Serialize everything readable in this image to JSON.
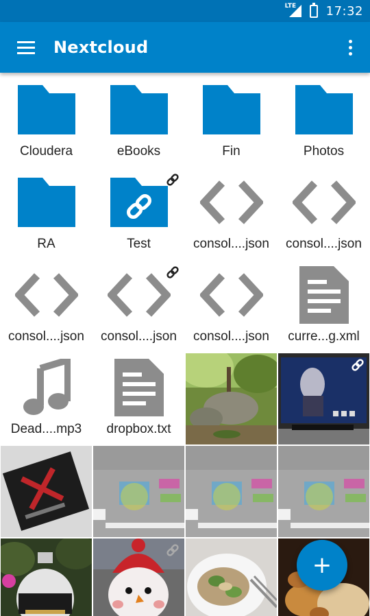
{
  "status_bar": {
    "network": "LTE",
    "time": "17:32"
  },
  "app_bar": {
    "title": "Nextcloud"
  },
  "colors": {
    "accent": "#0082c9",
    "statusbar": "#0072b5",
    "file_icon_gray": "#8c8c8c"
  },
  "items": [
    {
      "name": "Cloudera",
      "type": "folder",
      "icon": "folder-icon"
    },
    {
      "name": "eBooks",
      "type": "folder",
      "icon": "folder-icon"
    },
    {
      "name": "Fin",
      "type": "folder",
      "icon": "folder-icon"
    },
    {
      "name": "Photos",
      "type": "folder",
      "icon": "folder-icon"
    },
    {
      "name": "RA",
      "type": "folder",
      "icon": "folder-icon"
    },
    {
      "name": "Test",
      "type": "shared-folder",
      "icon": "link-folder-icon",
      "shared": true
    },
    {
      "name": "consol....json",
      "type": "code",
      "icon": "code-file-icon"
    },
    {
      "name": "consol....json",
      "type": "code",
      "icon": "code-file-icon"
    },
    {
      "name": "consol....json",
      "type": "code",
      "icon": "code-file-icon"
    },
    {
      "name": "consol....json",
      "type": "code",
      "icon": "code-file-icon",
      "shared": true
    },
    {
      "name": "consol....json",
      "type": "code",
      "icon": "code-file-icon"
    },
    {
      "name": "curre...g.xml",
      "type": "text",
      "icon": "document-file-icon"
    },
    {
      "name": "Dead....mp3",
      "type": "audio",
      "icon": "music-file-icon"
    },
    {
      "name": "dropbox.txt",
      "type": "text",
      "icon": "document-file-icon"
    }
  ],
  "photos": [
    {
      "thumb": "forest-photo"
    },
    {
      "thumb": "tv-photo",
      "shared": true
    },
    {
      "thumb": "book-photo"
    },
    {
      "thumb": "createjs-photo"
    },
    {
      "thumb": "createjs-photo"
    },
    {
      "thumb": "createjs-photo"
    },
    {
      "thumb": "ornament-photo"
    },
    {
      "thumb": "snowman-photo",
      "shared": true
    },
    {
      "thumb": "salad-photo"
    },
    {
      "thumb": "food-photo"
    }
  ],
  "fab": {
    "label": "+"
  }
}
